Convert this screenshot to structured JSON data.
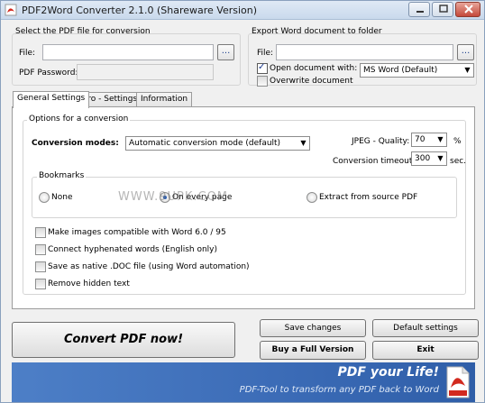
{
  "window": {
    "title": "PDF2Word Converter 2.1.0 (Shareware Version)"
  },
  "source": {
    "group_label": "Select the PDF file for conversion",
    "file_label": "File:",
    "file_value": "",
    "browse_label": "...",
    "password_label": "PDF Password:",
    "password_value": ""
  },
  "export": {
    "group_label": "Export Word document to folder",
    "file_label": "File:",
    "file_value": "",
    "browse_label": "...",
    "open_with_label": "Open document with:",
    "open_with_checked": true,
    "open_with_value": "MS Word (Default)",
    "overwrite_label": "Overwrite document",
    "overwrite_checked": false
  },
  "tabs": [
    {
      "label": "General Settings",
      "active": true
    },
    {
      "label": "Pro - Settings",
      "active": false
    },
    {
      "label": "Information",
      "active": false
    }
  ],
  "options": {
    "group_label": "Options for a conversion",
    "modes_label": "Conversion modes:",
    "modes_value": "Automatic conversion mode (default)",
    "jpeg_label": "JPEG - Quality:",
    "jpeg_value": "70",
    "jpeg_unit": "%",
    "timeout_label": "Conversion timeout:",
    "timeout_value": "300",
    "timeout_unit": "sec."
  },
  "bookmarks": {
    "group_label": "Bookmarks",
    "options": [
      {
        "label": "None",
        "checked": false
      },
      {
        "label": "On every page",
        "checked": true
      },
      {
        "label": "Extract from source PDF",
        "checked": false
      }
    ]
  },
  "checkboxes": [
    {
      "label": "Make images compatible with Word 6.0 / 95",
      "checked": false
    },
    {
      "label": "Connect hyphenated words (English only)",
      "checked": false
    },
    {
      "label": "Save as native .DOC file (using Word automation)",
      "checked": false
    },
    {
      "label": "Remove hidden text",
      "checked": false
    }
  ],
  "buttons": {
    "convert": "Convert PDF now!",
    "save_changes": "Save changes",
    "default_settings": "Default settings",
    "buy": "Buy a Full Version",
    "exit": "Exit"
  },
  "banner": {
    "title": "PDF your Life!",
    "subtitle": "PDF-Tool to transform any PDF back to Word"
  },
  "watermark": "WWW.9UPK.COM",
  "colors": {
    "accent": "#2b5fb4",
    "banner": "#3b6bb6",
    "pdf_red": "#d22a1f"
  }
}
